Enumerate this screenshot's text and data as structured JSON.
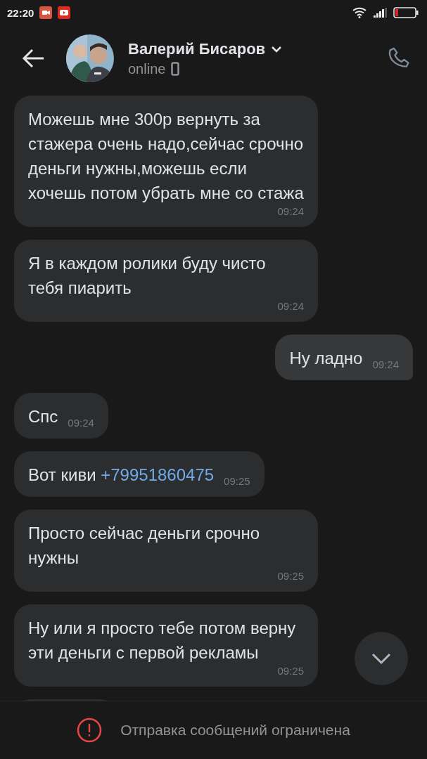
{
  "status_bar": {
    "time": "22:20"
  },
  "header": {
    "name": "Валерий Бисаров",
    "status": "online"
  },
  "messages": [
    {
      "outgoing": false,
      "text": "Можешь мне 300р вернуть за стажера очень надо,сейчас срочно деньги нужны,можешь если хочешь потом убрать мне со стажа",
      "time": "09:24"
    },
    {
      "outgoing": false,
      "text": "Я в каждом ролики буду чисто тебя пиарить",
      "time": "09:24"
    },
    {
      "outgoing": true,
      "text": "Ну ладно",
      "time": "09:24"
    },
    {
      "outgoing": false,
      "text": "Спс",
      "time": "09:24"
    },
    {
      "outgoing": false,
      "text": "Вот киви",
      "link": "+79951860475",
      "time": "09:25"
    },
    {
      "outgoing": false,
      "text": "Просто сейчас деньги срочно нужны",
      "time": "09:25"
    },
    {
      "outgoing": false,
      "text": "Ну или я просто тебе потом верну эти деньги с первой рекламы",
      "time": "09:25"
    }
  ],
  "notice": "Отправка сообщений ограничена"
}
